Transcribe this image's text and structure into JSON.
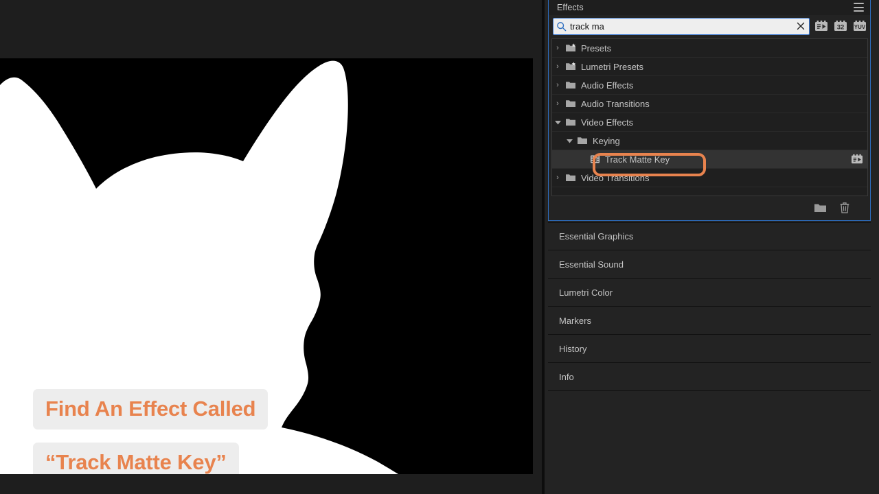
{
  "app": {
    "accent_orange": "#e8834e",
    "caption_bg": "#ededed",
    "panel_bg": "#232323",
    "focus_blue": "#2d6fc4"
  },
  "monitor": {
    "name": "program-monitor",
    "description": "Black and white alpha matte of an animal head silhouette",
    "captions": [
      {
        "text": "Find An Effect Called"
      },
      {
        "text": "“Track Matte Key”"
      }
    ]
  },
  "effects_panel": {
    "tab_label": "Effects",
    "menu_icon": "hamburger-menu-icon",
    "search": {
      "value": "track ma",
      "placeholder": "Search",
      "icon": "search-icon",
      "clear_icon": "close-icon"
    },
    "filters": [
      {
        "name": "accelerated-effects-filter",
        "label": "accelerated"
      },
      {
        "name": "32-bit-color-filter",
        "label": "32"
      },
      {
        "name": "yuv-color-filter",
        "label": "YUV"
      }
    ],
    "tree": [
      {
        "label": "Presets",
        "icon": "preset-folder-icon",
        "twisty": "›",
        "depth": 0,
        "selected": false,
        "badge": ""
      },
      {
        "label": "Lumetri Presets",
        "icon": "preset-folder-icon",
        "twisty": "›",
        "depth": 0,
        "selected": false,
        "badge": ""
      },
      {
        "label": "Audio Effects",
        "icon": "folder-icon",
        "twisty": "›",
        "depth": 0,
        "selected": false,
        "badge": ""
      },
      {
        "label": "Audio Transitions",
        "icon": "folder-icon",
        "twisty": "›",
        "depth": 0,
        "selected": false,
        "badge": ""
      },
      {
        "label": "Video Effects",
        "icon": "folder-icon",
        "twisty": "⌄",
        "depth": 0,
        "selected": false,
        "badge": ""
      },
      {
        "label": "Keying",
        "icon": "folder-icon",
        "twisty": "⌄",
        "depth": 1,
        "selected": false,
        "badge": ""
      },
      {
        "label": "Track Matte Key",
        "icon": "effect-icon",
        "twisty": "",
        "depth": 2,
        "selected": true,
        "badge": "accelerated-effects-badge"
      },
      {
        "label": "Video Transitions",
        "icon": "folder-icon",
        "twisty": "›",
        "depth": 0,
        "selected": false,
        "badge": ""
      }
    ],
    "footer": [
      {
        "name": "new-custom-bin-button",
        "icon": "folder-icon"
      },
      {
        "name": "delete-custom-item-button",
        "icon": "trash-icon"
      }
    ],
    "annotation": {
      "name": "track-matte-key-highlight",
      "target": "Track Matte Key",
      "color": "#e8834e"
    }
  },
  "collapsed_panels": [
    {
      "label": "Essential Graphics"
    },
    {
      "label": "Essential Sound"
    },
    {
      "label": "Lumetri Color"
    },
    {
      "label": "Markers"
    },
    {
      "label": "History"
    },
    {
      "label": "Info"
    }
  ]
}
